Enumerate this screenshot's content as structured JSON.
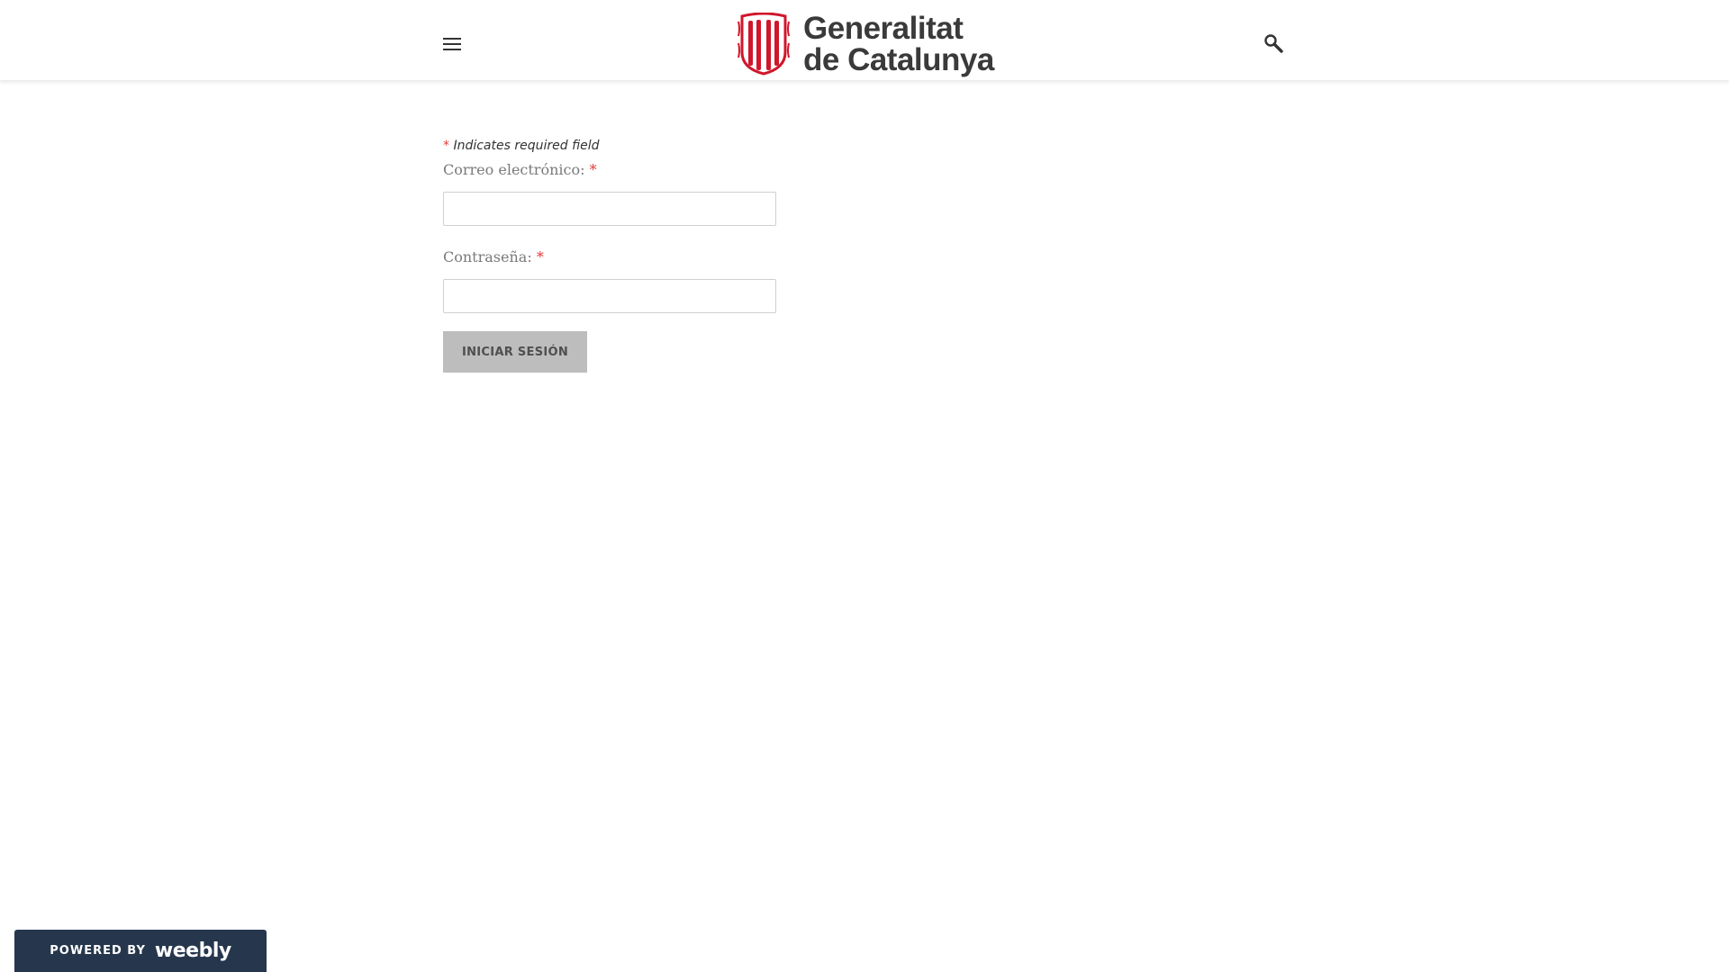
{
  "header": {
    "menu_icon": "hamburger-menu-icon",
    "logo": {
      "line1": "Generalitat",
      "line2": "de Catalunya",
      "emblem_color": "#d0162b",
      "text_color": "#3a3a3a"
    },
    "search_icon": "magnifier-search-icon"
  },
  "form": {
    "required_note": {
      "star": "*",
      "text": " Indicates required field"
    },
    "email": {
      "label": "Correo electrónico:",
      "star": "*",
      "value": ""
    },
    "password": {
      "label": "Contraseña:",
      "star": "*",
      "value": ""
    },
    "submit_label": "INICIAR SESIÓN"
  },
  "footer_badge": {
    "powered_by": "POWERED BY",
    "brand": "weebly",
    "background": "#26374d"
  }
}
